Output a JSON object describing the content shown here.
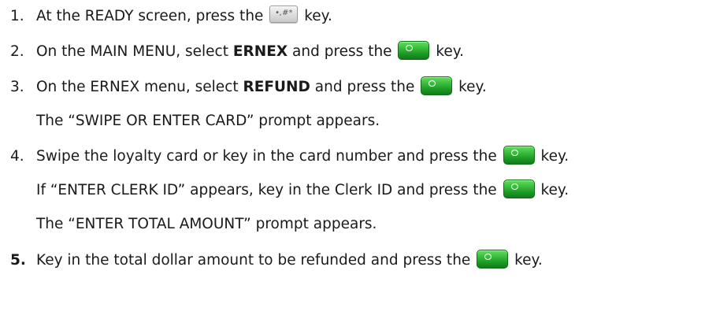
{
  "steps": [
    {
      "number": "1.",
      "before": "At the READY screen, press the",
      "after": "key.",
      "key_icon": "hash-key-icon"
    },
    {
      "number": "2.",
      "before": "On the MAIN MENU, select",
      "bold": "ERNEX",
      "middle": "and press the",
      "after": "key.",
      "key_icon": "green-enter-key-icon"
    },
    {
      "number": "3.",
      "before": "On the ERNEX menu, select",
      "bold": "REFUND",
      "middle": "and press the",
      "after": "key.",
      "key_icon": "green-enter-key-icon",
      "note": "The “SWIPE OR ENTER CARD” prompt appears."
    },
    {
      "number": "4.",
      "before": "Swipe the loyalty card or key in the card number and press the",
      "after": "key.",
      "key_icon": "green-enter-key-icon",
      "note1_before": "If “ENTER CLERK ID” appears, key in the Clerk ID and press the",
      "note1_after": "key.",
      "note2": "The “ENTER TOTAL AMOUNT” prompt appears."
    },
    {
      "number": "5.",
      "before": "Key in the total dollar amount to be refunded and press the",
      "after": "key.",
      "key_icon": "green-enter-key-icon"
    }
  ],
  "hash_key_glyph": "•,#*",
  "colors": {
    "text": "#1a1a1a",
    "green_key": "#1c9a25"
  }
}
